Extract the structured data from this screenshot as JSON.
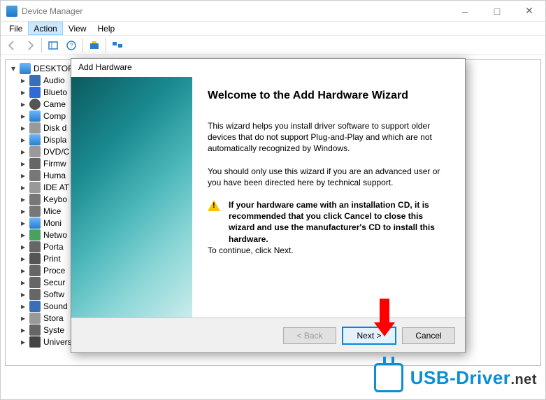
{
  "window": {
    "title": "Device Manager",
    "min_tip": "Minimize",
    "max_tip": "Maximize",
    "close_tip": "Close"
  },
  "menu": {
    "file": "File",
    "action": "Action",
    "view": "View",
    "help": "Help"
  },
  "tree": {
    "root": "DESKTOP",
    "items": [
      {
        "label": "Audio",
        "icon": "audio"
      },
      {
        "label": "Blueto",
        "icon": "bt"
      },
      {
        "label": "Came",
        "icon": "cam"
      },
      {
        "label": "Comp",
        "icon": "mon"
      },
      {
        "label": "Disk d",
        "icon": "disk"
      },
      {
        "label": "Displa",
        "icon": "mon"
      },
      {
        "label": "DVD/C",
        "icon": "disk"
      },
      {
        "label": "Firmw",
        "icon": "sys"
      },
      {
        "label": "Huma",
        "icon": "kb"
      },
      {
        "label": "IDE AT",
        "icon": "disk"
      },
      {
        "label": "Keybo",
        "icon": "kb"
      },
      {
        "label": "Mice",
        "icon": "kb"
      },
      {
        "label": "Moni",
        "icon": "mon"
      },
      {
        "label": "Netwo",
        "icon": "net"
      },
      {
        "label": "Porta",
        "icon": "sys"
      },
      {
        "label": "Print",
        "icon": "print"
      },
      {
        "label": "Proce",
        "icon": "sys"
      },
      {
        "label": "Secur",
        "icon": "sys"
      },
      {
        "label": "Softw",
        "icon": "sys"
      },
      {
        "label": "Sound",
        "icon": "audio"
      },
      {
        "label": "Stora",
        "icon": "disk"
      },
      {
        "label": "Syste",
        "icon": "sys"
      },
      {
        "label": "Universal Serial Bus controllers",
        "icon": "usb"
      }
    ]
  },
  "dialog": {
    "title": "Add Hardware",
    "heading": "Welcome to the Add Hardware Wizard",
    "para1": "This wizard helps you install driver software to support older devices that do not support Plug-and-Play and which are not automatically recognized by Windows.",
    "para2": "You should only use this wizard if you are an advanced user or you have been directed here by technical support.",
    "warning": "If your hardware came with an installation CD, it is recommended that you click Cancel to close this wizard and use the manufacturer's CD to install this hardware.",
    "continue": "To continue, click Next.",
    "back": "< Back",
    "next": "Next >",
    "cancel": "Cancel"
  },
  "watermark": {
    "brand": "USB-Driver",
    "suffix": ".net"
  }
}
